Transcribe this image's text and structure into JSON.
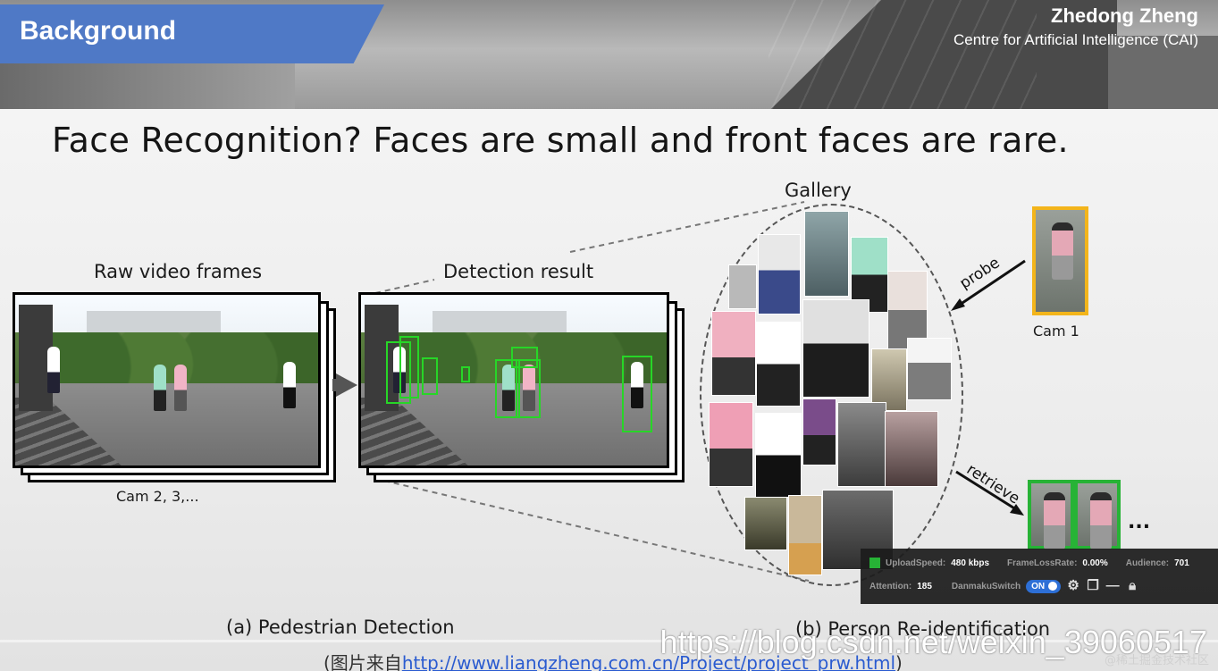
{
  "header": {
    "section_title": "Background",
    "author": "Zhedong Zheng",
    "affiliation": "Centre for Artificial Intelligence (CAI)"
  },
  "slide": {
    "headline": "Face Recognition? Faces are small and front faces are rare.",
    "raw_label": "Raw video frames",
    "detection_label": "Detection result",
    "gallery_label": "Gallery",
    "cams_label": "Cam 2, 3,...",
    "cam1_label": "Cam 1",
    "probe_label": "probe",
    "retrieve_label": "retrieve",
    "ellipsis": "...",
    "caption_a": "(a) Pedestrian Detection",
    "caption_b": "(b) Person Re-identification",
    "source_prefix": "(图片来自",
    "source_link": "http://www.liangzheng.com.cn/Project/project_prw.html",
    "source_suffix": ")"
  },
  "stream_overlay": {
    "upload_speed_label": "UploadSpeed:",
    "upload_speed_value": "480 kbps",
    "frame_loss_label": "FrameLossRate:",
    "frame_loss_value": "0.00%",
    "audience_label": "Audience:",
    "audience_value": "701",
    "attention_label": "Attention:",
    "attention_value": "185",
    "danmaku_label": "DanmakuSwitch",
    "danmaku_state": "ON",
    "icons": [
      "settings-icon",
      "chat-icon",
      "minimize-icon",
      "lock-icon"
    ]
  },
  "watermark": {
    "url": "https://blog.csdn.net/weixin_39060517",
    "sub": "@稀土掘金技术社区"
  },
  "colors": {
    "banner": "#4f79c6",
    "probe_border": "#f3b51b",
    "match_border": "#27b336",
    "bbox": "#27d627"
  }
}
